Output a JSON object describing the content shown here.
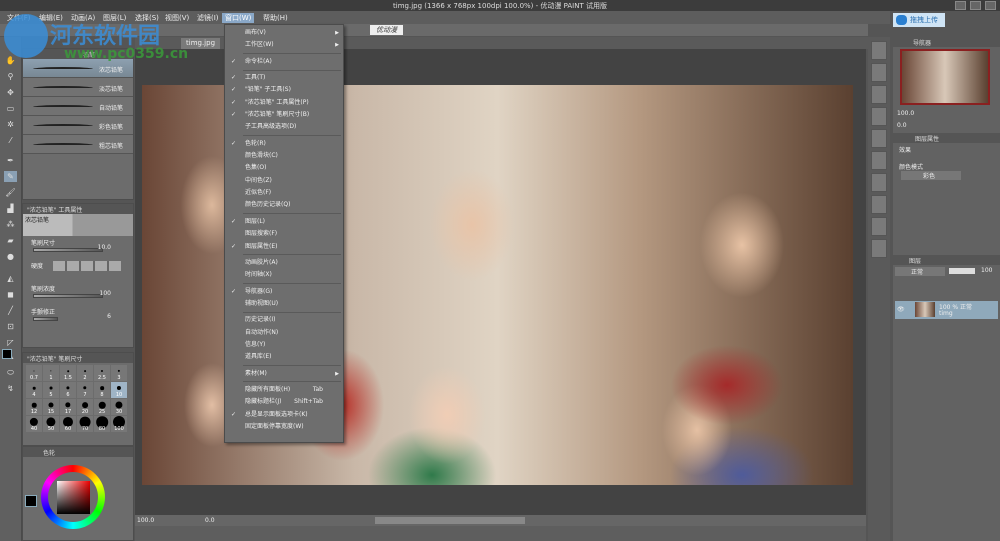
{
  "title": "timg.jpg (1366 x 768px 100dpi 100.0%) - 优动漫 PAINT 试用版",
  "menus": [
    "文件(F)",
    "编辑(E)",
    "动画(A)",
    "图层(L)",
    "选择(S)",
    "视图(V)",
    "滤镜(I)",
    "窗口(W)",
    "帮助(H)"
  ],
  "active_menu": "窗口(W)",
  "watermark": {
    "name": "河东软件园",
    "url": "www.pc0359.cn"
  },
  "toolbar": {
    "badge": "优动漫"
  },
  "doc_tab": "timg.jpg",
  "window_menu": [
    {
      "label": "画布(V)",
      "sub": true
    },
    {
      "label": "工作区(W)",
      "sub": true
    },
    {
      "sep": true
    },
    {
      "label": "命令栏(A)",
      "check": true
    },
    {
      "sep": true
    },
    {
      "label": "工具(T)",
      "check": true
    },
    {
      "label": "\"铅笔\" 子工具(S)",
      "check": true
    },
    {
      "label": "\"浓芯铅笔\" 工具属性(P)",
      "check": true
    },
    {
      "label": "\"浓芯铅笔\" 笔刷尺寸(B)",
      "check": true
    },
    {
      "label": "子工具高级选项(D)"
    },
    {
      "sep": true
    },
    {
      "label": "色轮(R)",
      "check": true
    },
    {
      "label": "颜色滑块(C)"
    },
    {
      "label": "色集(O)"
    },
    {
      "label": "中间色(Z)"
    },
    {
      "label": "近似色(F)"
    },
    {
      "label": "颜色历史记录(Q)"
    },
    {
      "sep": true
    },
    {
      "label": "图层(L)",
      "check": true
    },
    {
      "label": "图层搜索(F)"
    },
    {
      "label": "图层属性(E)",
      "check": true
    },
    {
      "sep": true
    },
    {
      "label": "动画胶片(A)"
    },
    {
      "label": "时间轴(X)"
    },
    {
      "sep": true
    },
    {
      "label": "导航器(G)",
      "check": true
    },
    {
      "label": "辅助视图(U)"
    },
    {
      "sep": true
    },
    {
      "label": "历史记录(I)"
    },
    {
      "label": "自动动作(N)"
    },
    {
      "label": "信息(Y)"
    },
    {
      "label": "道具库(E)"
    },
    {
      "sep": true
    },
    {
      "label": "素材(M)",
      "sub": true
    },
    {
      "sep": true
    },
    {
      "label": "隐藏所有面板(H)",
      "shortcut": "Tab"
    },
    {
      "label": "隐藏标题栏(J)",
      "shortcut": "Shift+Tab"
    },
    {
      "label": "总是显示面板选项卡(K)",
      "check": true
    },
    {
      "label": "固定面板停靠宽度(W)"
    }
  ],
  "subtool": {
    "tab": "铅笔",
    "brushes": [
      "浓芯铅笔",
      "淡芯铅笔",
      "自动铅笔",
      "彩色铅笔",
      "粗芯铅笔"
    ],
    "selected": 0
  },
  "toolprop": {
    "header": "\"浓芯铅笔\" 工具属性",
    "preview": "浓芯铅笔",
    "size_label": "笔刷尺寸",
    "size": "10.0",
    "hardness_label": "硬度",
    "density_label": "笔刷浓度",
    "density": "100",
    "stab_label": "手颤修正",
    "stab": "6"
  },
  "brushsize": {
    "header": "\"浓芯铅笔\" 笔刷尺寸",
    "sizes": [
      "0.7",
      "1",
      "1.5",
      "2",
      "2.5",
      "3",
      "4",
      "5",
      "6",
      "7",
      "8",
      "10",
      "12",
      "15",
      "17",
      "20",
      "25",
      "30",
      "40",
      "50",
      "60",
      "70",
      "80",
      "100"
    ],
    "selected": "10"
  },
  "color": {
    "tab": "色轮",
    "main": "#000000",
    "sub": "#ffffff"
  },
  "upload": "拖拽上传",
  "navigator": {
    "tab": "导航器",
    "zoom": "100.0",
    "rotate": "0.0"
  },
  "layerprop": {
    "tab": "图层属性",
    "effect": "效果",
    "color_mode": "颜色模式",
    "mode_value": "彩色"
  },
  "layers": {
    "tab": "图层",
    "blend": "正常",
    "opacity": "100",
    "items": [
      {
        "info": "100 % 正常",
        "name": "timg"
      }
    ]
  },
  "status": {
    "zoom": "100.0",
    "rotate": "0.0"
  },
  "accent": "#8aa8c8"
}
